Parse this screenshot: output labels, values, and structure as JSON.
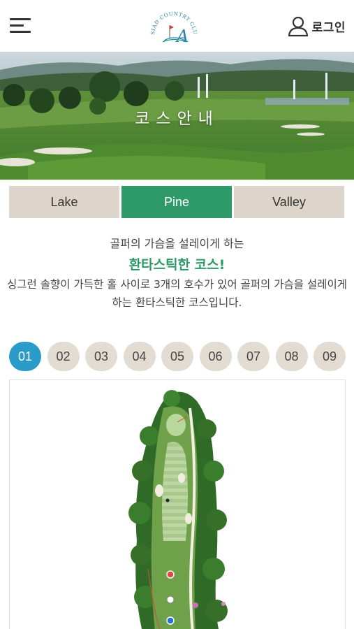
{
  "header": {
    "menu_icon": "hamburger-menu-icon",
    "logo_text": "ASIAD COUNTRY CLUB",
    "logo_letter": "A",
    "login_icon": "user-icon",
    "login_label": "로그인"
  },
  "hero": {
    "title": "코스안내"
  },
  "tabs": [
    {
      "label": "Lake",
      "active": false
    },
    {
      "label": "Pine",
      "active": true
    },
    {
      "label": "Valley",
      "active": false
    }
  ],
  "intro": {
    "subtitle": "골퍼의 가슴을 설레이게 하는",
    "title": "환타스틱한 코스!",
    "description": "싱그런 솔향이 가득한 홀 사이로 3개의 호수가 있어 골퍼의 가슴을 설레이게 하는 환타스틱한 코스입니다."
  },
  "holes": [
    {
      "label": "01",
      "active": true
    },
    {
      "label": "02",
      "active": false
    },
    {
      "label": "03",
      "active": false
    },
    {
      "label": "04",
      "active": false
    },
    {
      "label": "05",
      "active": false
    },
    {
      "label": "06",
      "active": false
    },
    {
      "label": "07",
      "active": false
    },
    {
      "label": "08",
      "active": false
    },
    {
      "label": "09",
      "active": false
    }
  ],
  "colors": {
    "accent_green": "#2e9a6a",
    "active_hole_blue": "#2b9bc9",
    "tab_inactive": "#ddd5cb",
    "hole_inactive": "#e2dcd3"
  }
}
